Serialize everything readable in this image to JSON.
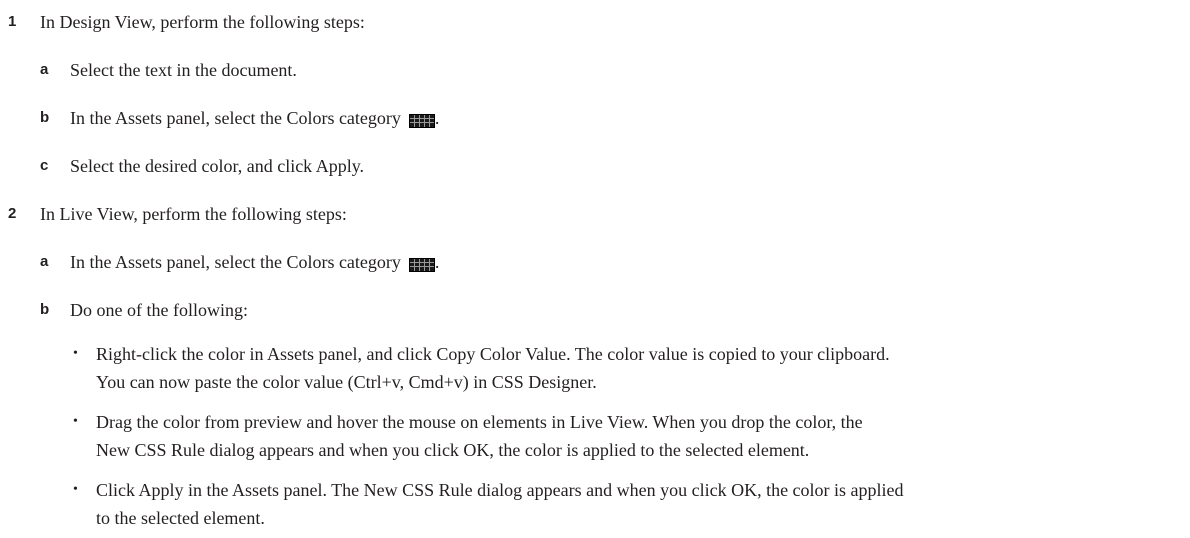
{
  "steps": [
    {
      "number": "1",
      "text": "In Design View, perform the following steps:",
      "substeps": [
        {
          "letter": "a",
          "text": "Select the text in the document."
        },
        {
          "letter": "b",
          "text": "In the Assets panel, select the Colors category",
          "suffix": ".",
          "icon": "colors-grid-icon"
        },
        {
          "letter": "c",
          "text": "Select the desired color, and click Apply."
        }
      ]
    },
    {
      "number": "2",
      "text": "In Live View, perform the following steps:",
      "substeps": [
        {
          "letter": "a",
          "text": "In the Assets panel, select the Colors category",
          "suffix": ".",
          "icon": "colors-grid-icon"
        },
        {
          "letter": "b",
          "text": "Do one of the following:"
        }
      ],
      "bullets": [
        {
          "line1": "Right-click the color in Assets panel, and click Copy Color Value. The color value is copied to your clipboard.",
          "line2": "You can now paste the color value (Ctrl+v, Cmd+v) in CSS Designer."
        },
        {
          "line1": "Drag the color from preview and hover the mouse on elements in Live View. When you drop the color, the",
          "line2": "New CSS Rule dialog appears and when you click OK, the color is applied to the selected element."
        },
        {
          "line1": "Click Apply in the Assets panel. The New CSS Rule dialog appears and when you click OK, the color is applied",
          "line2": "to the selected element."
        }
      ]
    }
  ],
  "bullet_char": "•"
}
